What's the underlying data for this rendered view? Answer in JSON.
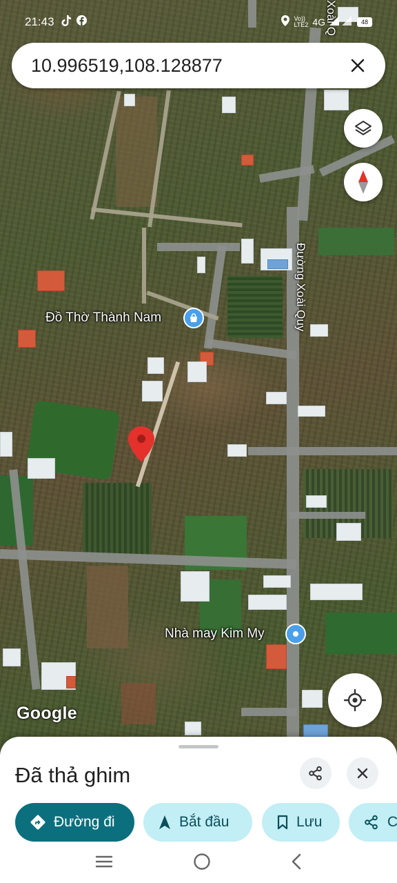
{
  "status_bar": {
    "time": "21:43",
    "network_top": "Vo))",
    "network_bottom": "LTE2",
    "network_type": "4G",
    "battery": "48"
  },
  "search": {
    "query": "10.996519,108.128877"
  },
  "map": {
    "road_label": "Đường Xoài Quy",
    "road_label_top": "Xoài Q",
    "poi_temple": "Đồ Thờ Thành Nam",
    "poi_shop": "Nhà may Kim My",
    "google_logo": "Google"
  },
  "sheet": {
    "title": "Đã thả ghim",
    "chips": [
      {
        "label": "Đường đi",
        "icon": "directions-icon"
      },
      {
        "label": "Bắt đầu",
        "icon": "navigation-arrow-icon"
      },
      {
        "label": "Lưu",
        "icon": "bookmark-icon"
      },
      {
        "label": "Ch",
        "icon": "share-icon"
      }
    ]
  },
  "colors": {
    "primary_chip": "#0b6f7e",
    "secondary_chip": "#c2eef5",
    "pin": "#e5312b",
    "poi_icon": "#4aa0ea"
  }
}
